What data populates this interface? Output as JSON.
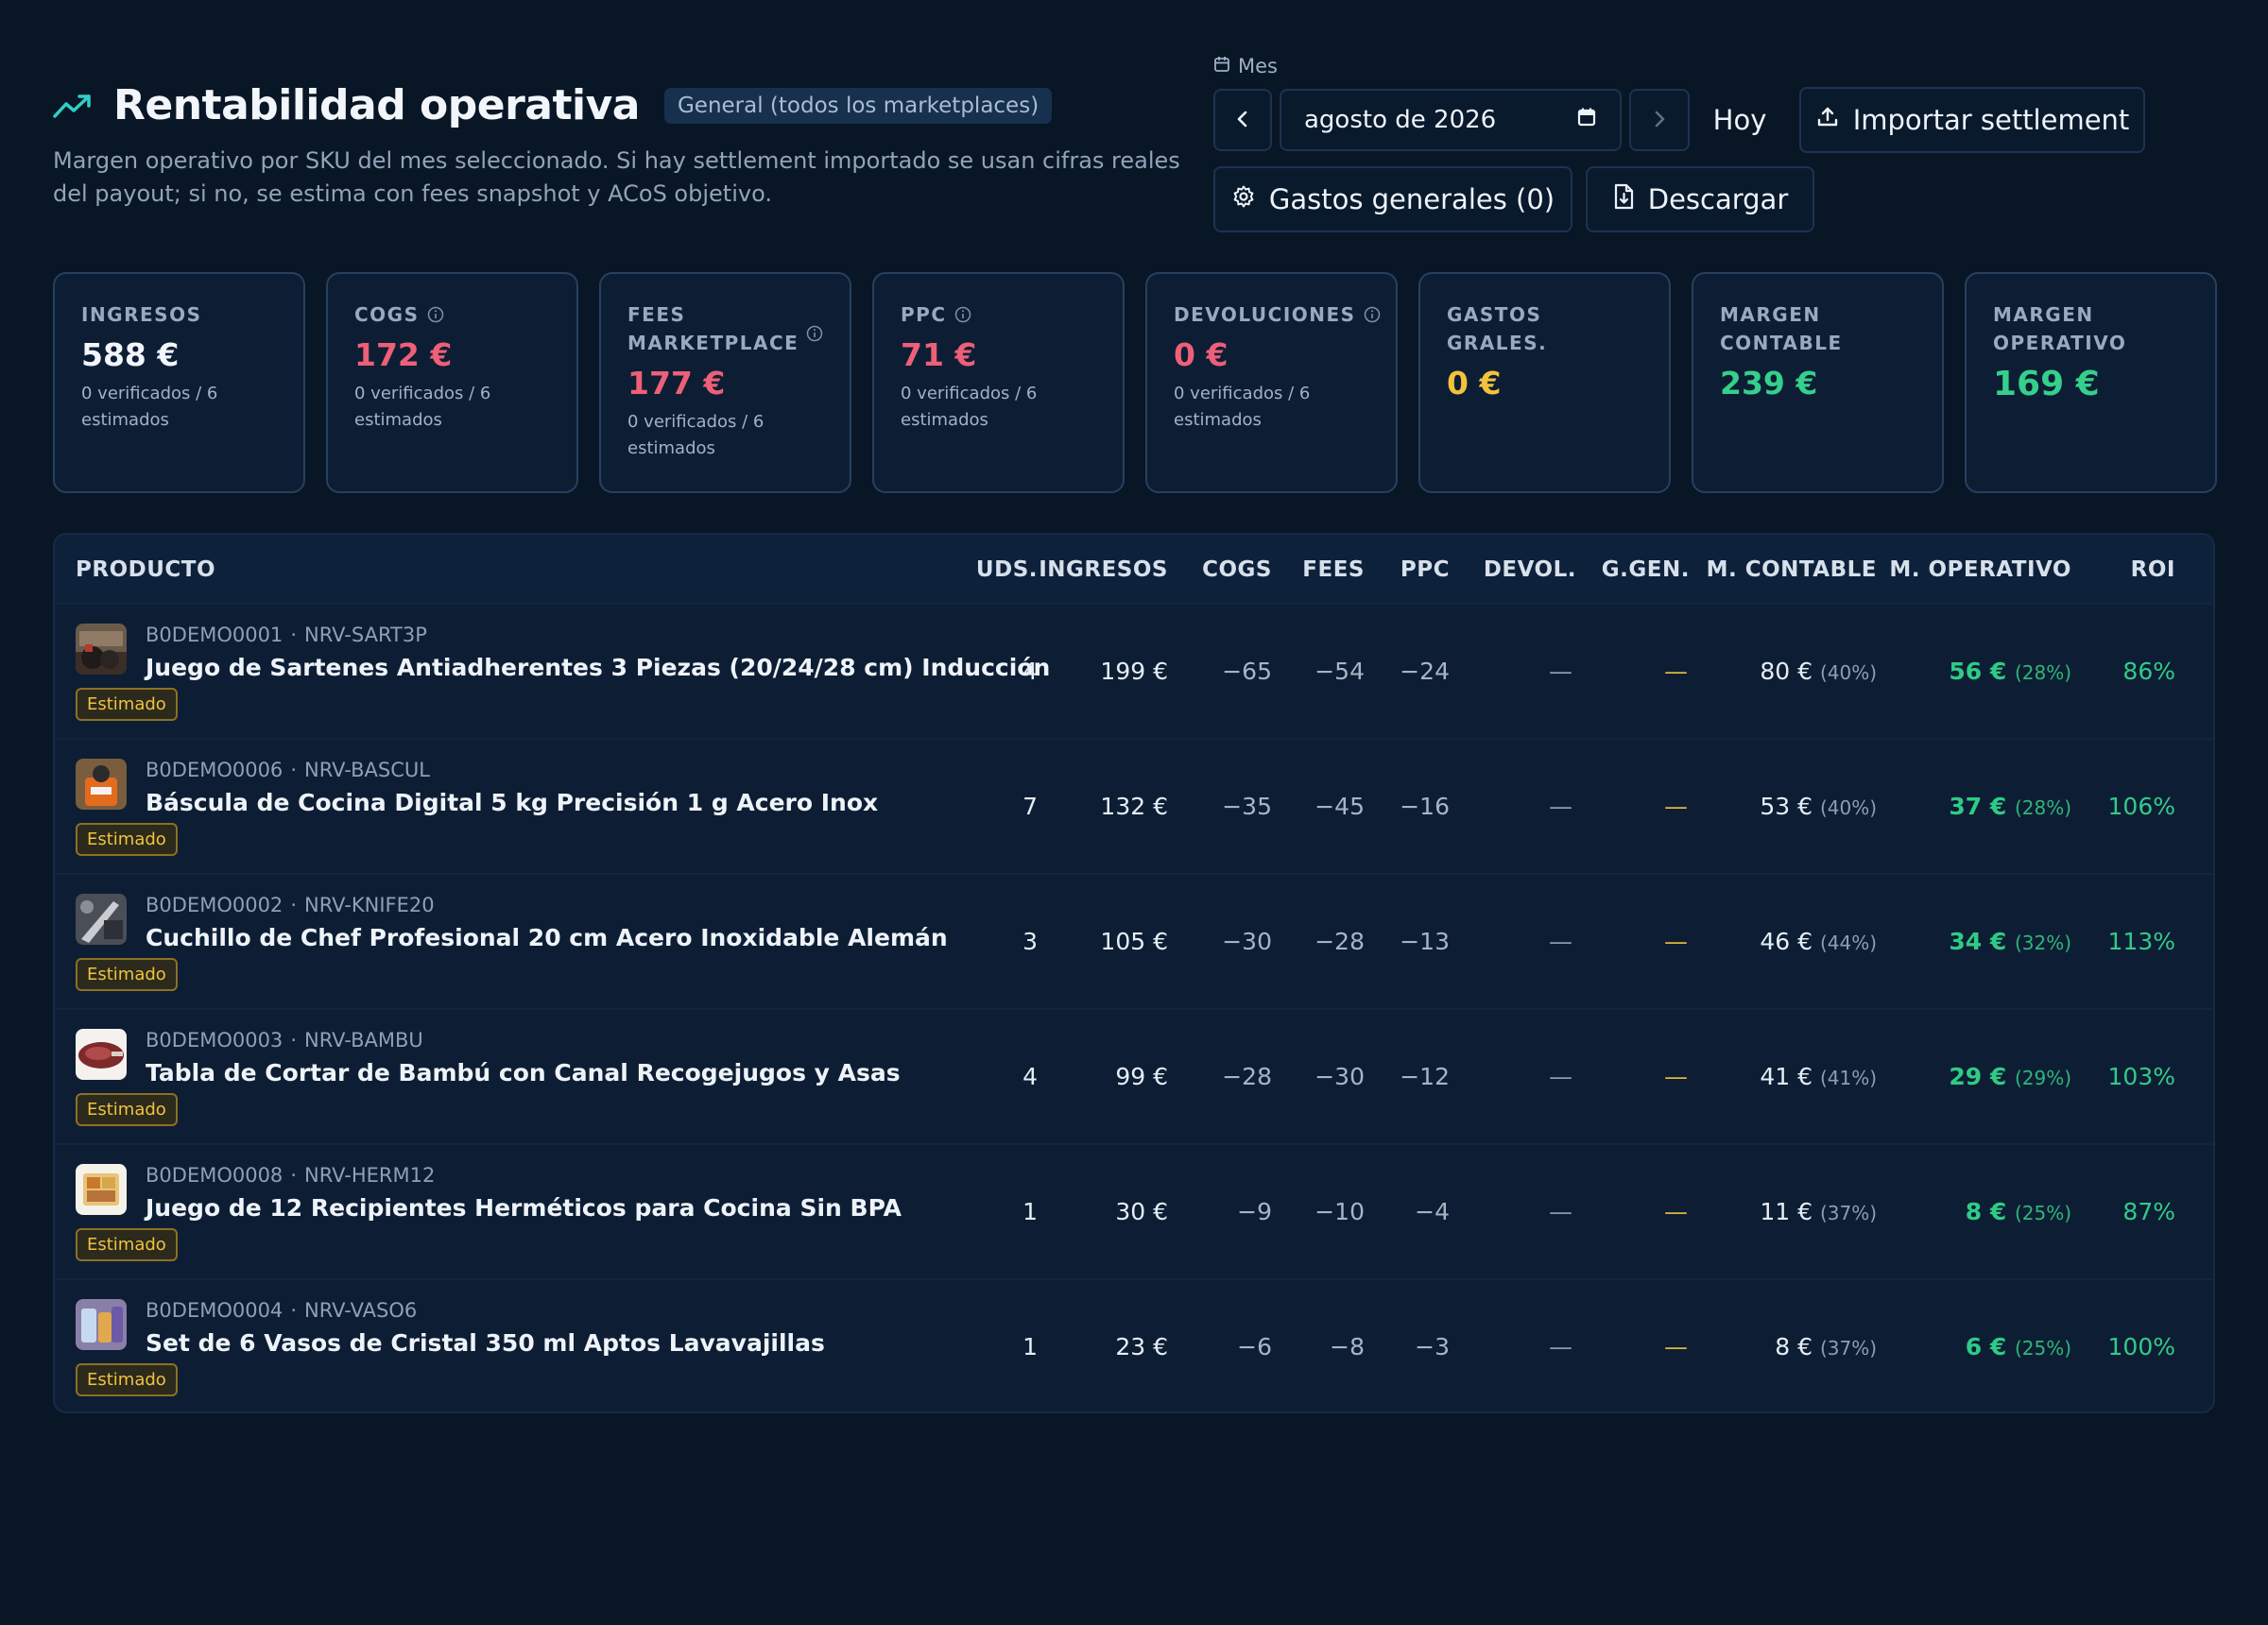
{
  "header": {
    "title": "Rentabilidad operativa",
    "scope_badge": "General (todos los marketplaces)",
    "subtitle": "Margen operativo por SKU del mes seleccionado. Si hay settlement importado se usan cifras reales del payout; si no, se estima con fees snapshot y ACoS objetivo.",
    "icon": "trending-up-icon"
  },
  "controls": {
    "month_label": "Mes",
    "month_value": "agosto de 2026",
    "today_label": "Hoy",
    "import_label": "Importar settlement",
    "gastos_label": "Gastos generales (0)",
    "download_label": "Descargar"
  },
  "cards": [
    {
      "label": "INGRESOS",
      "value": "588 €",
      "note": "0 verificados / 6 estimados",
      "color": "#f2f6fb"
    },
    {
      "label": "COGS",
      "value": "172 €",
      "note": "0 verificados / 6 estimados",
      "color": "#ee5f78"
    },
    {
      "label": "FEES MARKETPLACE",
      "value": "177 €",
      "note": "0 verificados / 6 estimados",
      "color": "#ee5f78"
    },
    {
      "label": "PPC",
      "value": "71 €",
      "note": "0 verificados / 6 estimados",
      "color": "#ee5f78"
    },
    {
      "label": "DEVOLUCIONES",
      "value": "0 €",
      "note": "0 verificados / 6 estimados",
      "color": "#ee5f78"
    },
    {
      "label": "GASTOS GRALES.",
      "value": "0 €",
      "note": "",
      "color": "#f2c23c"
    },
    {
      "label": "MARGEN CONTABLE",
      "value": "239 €",
      "note": "",
      "color": "#34d08c"
    },
    {
      "label": "MARGEN OPERATIVO",
      "value": "169 €",
      "note": "",
      "color": "#34d08c"
    }
  ],
  "table": {
    "columns": [
      "PRODUCTO",
      "UDS.",
      "INGRESOS",
      "COGS",
      "FEES",
      "PPC",
      "DEVOL.",
      "G.GEN.",
      "M. CONTABLE",
      "M. OPERATIVO",
      "ROI"
    ],
    "badge_label": "Estimado",
    "rows": [
      {
        "asin": "B0DEMO0001",
        "sku": "NRV-SART3P",
        "name": "Juego de Sartenes Antiadherentes 3 Piezas (20/24/28 cm) Inducción",
        "uds": "4",
        "ingresos": "199 €",
        "cogs": "−65",
        "fees": "−54",
        "ppc": "−24",
        "devol": "—",
        "ggen": "—",
        "mc": "80 €",
        "mc_pct": "(40%)",
        "mo": "56 €",
        "mo_pct": "(28%)",
        "roi": "86%"
      },
      {
        "asin": "B0DEMO0006",
        "sku": "NRV-BASCUL",
        "name": "Báscula de Cocina Digital 5 kg Precisión 1 g Acero Inox",
        "uds": "7",
        "ingresos": "132 €",
        "cogs": "−35",
        "fees": "−45",
        "ppc": "−16",
        "devol": "—",
        "ggen": "—",
        "mc": "53 €",
        "mc_pct": "(40%)",
        "mo": "37 €",
        "mo_pct": "(28%)",
        "roi": "106%"
      },
      {
        "asin": "B0DEMO0002",
        "sku": "NRV-KNIFE20",
        "name": "Cuchillo de Chef Profesional 20 cm Acero Inoxidable Alemán",
        "uds": "3",
        "ingresos": "105 €",
        "cogs": "−30",
        "fees": "−28",
        "ppc": "−13",
        "devol": "—",
        "ggen": "—",
        "mc": "46 €",
        "mc_pct": "(44%)",
        "mo": "34 €",
        "mo_pct": "(32%)",
        "roi": "113%"
      },
      {
        "asin": "B0DEMO0003",
        "sku": "NRV-BAMBU",
        "name": "Tabla de Cortar de Bambú con Canal Recogejugos y Asas",
        "uds": "4",
        "ingresos": "99 €",
        "cogs": "−28",
        "fees": "−30",
        "ppc": "−12",
        "devol": "—",
        "ggen": "—",
        "mc": "41 €",
        "mc_pct": "(41%)",
        "mo": "29 €",
        "mo_pct": "(29%)",
        "roi": "103%"
      },
      {
        "asin": "B0DEMO0008",
        "sku": "NRV-HERM12",
        "name": "Juego de 12 Recipientes Herméticos para Cocina Sin BPA",
        "uds": "1",
        "ingresos": "30 €",
        "cogs": "−9",
        "fees": "−10",
        "ppc": "−4",
        "devol": "—",
        "ggen": "—",
        "mc": "11 €",
        "mc_pct": "(37%)",
        "mo": "8 €",
        "mo_pct": "(25%)",
        "roi": "87%"
      },
      {
        "asin": "B0DEMO0004",
        "sku": "NRV-VASO6",
        "name": "Set de 6 Vasos de Cristal 350 ml Aptos Lavavajillas",
        "uds": "1",
        "ingresos": "23 €",
        "cogs": "−6",
        "fees": "−8",
        "ppc": "−3",
        "devol": "—",
        "ggen": "—",
        "mc": "8 €",
        "mc_pct": "(37%)",
        "mo": "6 €",
        "mo_pct": "(25%)",
        "roi": "100%"
      }
    ]
  }
}
